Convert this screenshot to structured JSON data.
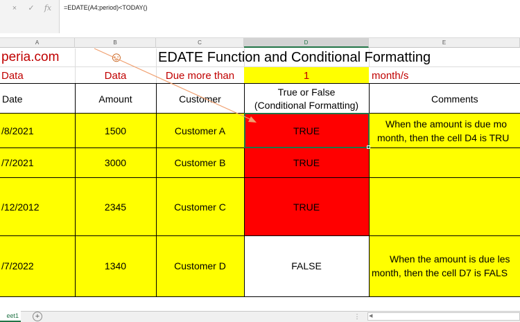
{
  "formula_bar": {
    "cancel_icon": "×",
    "enter_icon": "✓",
    "fx_label": "fx",
    "formula": "=EDATE(A4;period)<TODAY()"
  },
  "columns": [
    "A",
    "B",
    "C",
    "D",
    "E"
  ],
  "selected_column": "D",
  "row1": {
    "brand": "peria.com",
    "smiley": "☺",
    "title": "EDATE Function and Conditional Formatting"
  },
  "row2": {
    "a": "Data",
    "b": "Data",
    "c": "Due more than",
    "d": "1",
    "e": "month/s"
  },
  "headers": {
    "date": "Date",
    "amount": "Amount",
    "customer": "Customer",
    "true_false_line1": "True or False",
    "true_false_line2": "(Conditional Formatting)",
    "comments": "Comments"
  },
  "rows": [
    {
      "date": "/8/2021",
      "amount": "1500",
      "customer": "Customer A",
      "result": "TRUE",
      "comment1": "When the amount is due mo",
      "comment2": "month, then the cell D4 is TRU"
    },
    {
      "date": "/7/2021",
      "amount": "3000",
      "customer": "Customer B",
      "result": "TRUE",
      "comment1": "",
      "comment2": ""
    },
    {
      "date": "/12/2012",
      "amount": "2345",
      "customer": "Customer C",
      "result": "TRUE",
      "comment1": "",
      "comment2": ""
    },
    {
      "date": "/7/2022",
      "amount": "1340",
      "customer": "Customer D",
      "result": "FALSE",
      "comment1": "When the amount is due les",
      "comment2": "month, then the cell D7 is FALS"
    }
  ],
  "sheet_tab": "eet1",
  "add_sheet_icon": "+",
  "colors": {
    "yellow": "#ffff00",
    "red": "#ff0000",
    "brand_red": "#c00000",
    "excel_green": "#217346",
    "arrow": "#f0a070"
  }
}
